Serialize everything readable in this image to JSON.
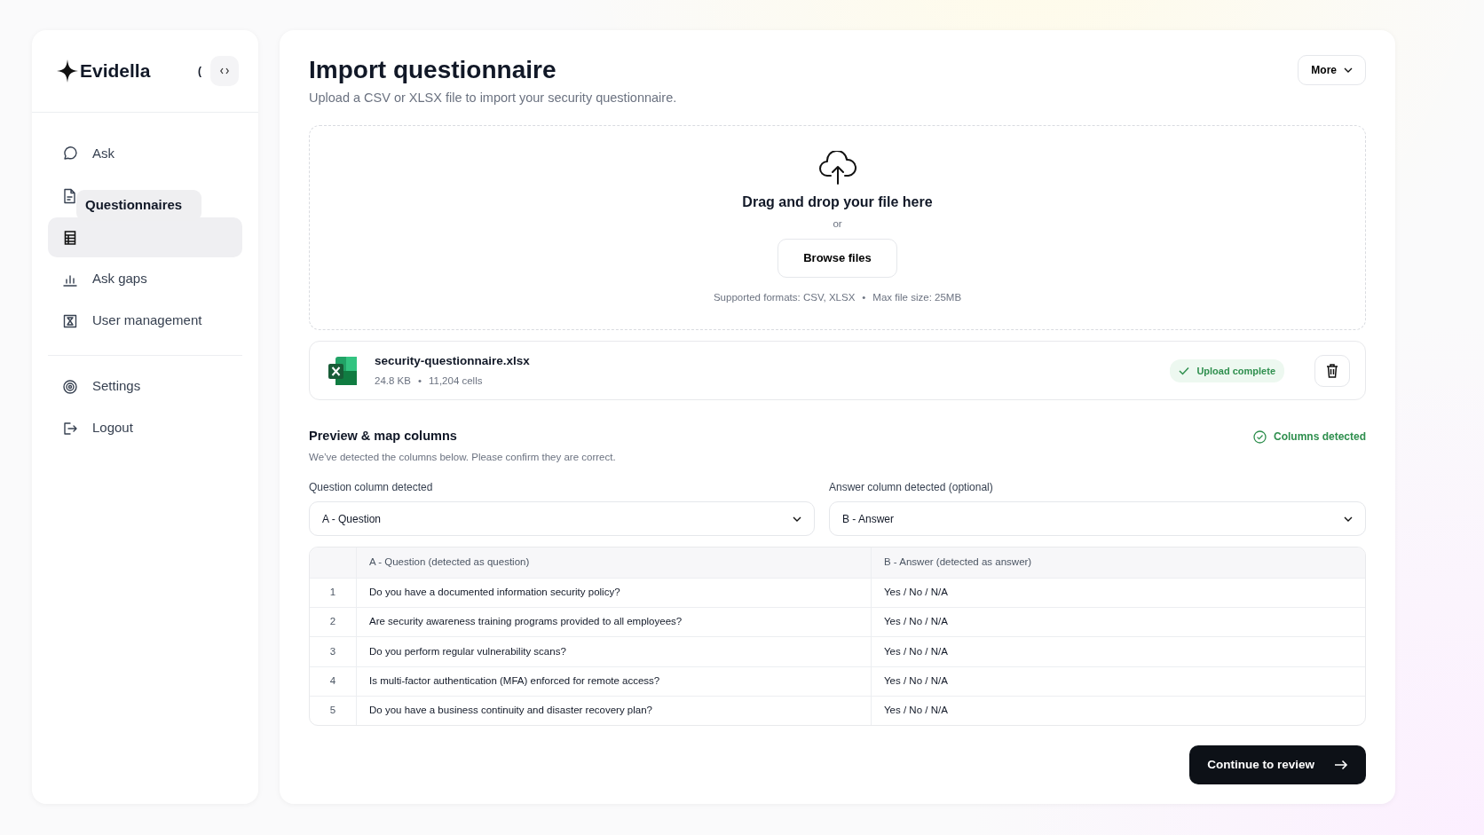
{
  "brand": {
    "name": "Evidella",
    "glyph": "("
  },
  "nav": [
    {
      "kind": "chat",
      "label": "Ask",
      "selected": false
    },
    {
      "kind": "doc",
      "selected": false
    },
    {
      "kind": "sheet",
      "selected": true
    },
    {
      "kind": "chart",
      "label": "Ask gaps",
      "selected": false
    },
    {
      "kind": "user",
      "label": "User management",
      "selected": false
    }
  ],
  "tooltip": "Questionnaires",
  "footer_nav": [
    {
      "kind": "gear",
      "label": "Settings"
    },
    {
      "kind": "logout",
      "label": "Logout"
    }
  ],
  "page": {
    "title": "Import questionnaire",
    "subtitle": "Upload a CSV or XLSX file to import your security questionnaire.",
    "more_button": "More"
  },
  "dropzone": {
    "heading": "Drag and drop your file here",
    "or": "or",
    "button": "Browse files",
    "formats": "Supported formats: CSV, XLSX",
    "separator": "•",
    "max_size": "Max file size: 25MB"
  },
  "file": {
    "name": "security-questionnaire.xlsx",
    "size": "24.8 KB",
    "separator": "•",
    "cells": "11,204 cells",
    "status": "Upload complete"
  },
  "preview": {
    "title": "Preview & map columns",
    "subtitle": "We’ve detected the columns below. Please confirm they are correct.",
    "status": "Columns detected"
  },
  "mappings": [
    {
      "label": "Question column detected",
      "value": "A - Question"
    },
    {
      "label": "Answer column detected (optional)",
      "value": "B - Answer"
    }
  ],
  "table": {
    "columns": [
      "A - Question (detected as question)",
      "B - Answer (detected as answer)"
    ],
    "rows": [
      {
        "index": "1",
        "question": "Do you have a documented information security policy?",
        "answer": "Yes / No / N/A"
      },
      {
        "index": "2",
        "question": "Are security awareness training programs provided to all employees?",
        "answer": "Yes / No / N/A"
      },
      {
        "index": "3",
        "question": "Do you perform regular vulnerability scans?",
        "answer": "Yes / No / N/A"
      },
      {
        "index": "4",
        "question": "Is multi-factor authentication (MFA) enforced for remote access?",
        "answer": "Yes / No / N/A"
      },
      {
        "index": "5",
        "question": "Do you have a business continuity and disaster recovery plan?",
        "answer": "Yes / No / N/A"
      }
    ]
  },
  "continue_button": "Continue to review"
}
